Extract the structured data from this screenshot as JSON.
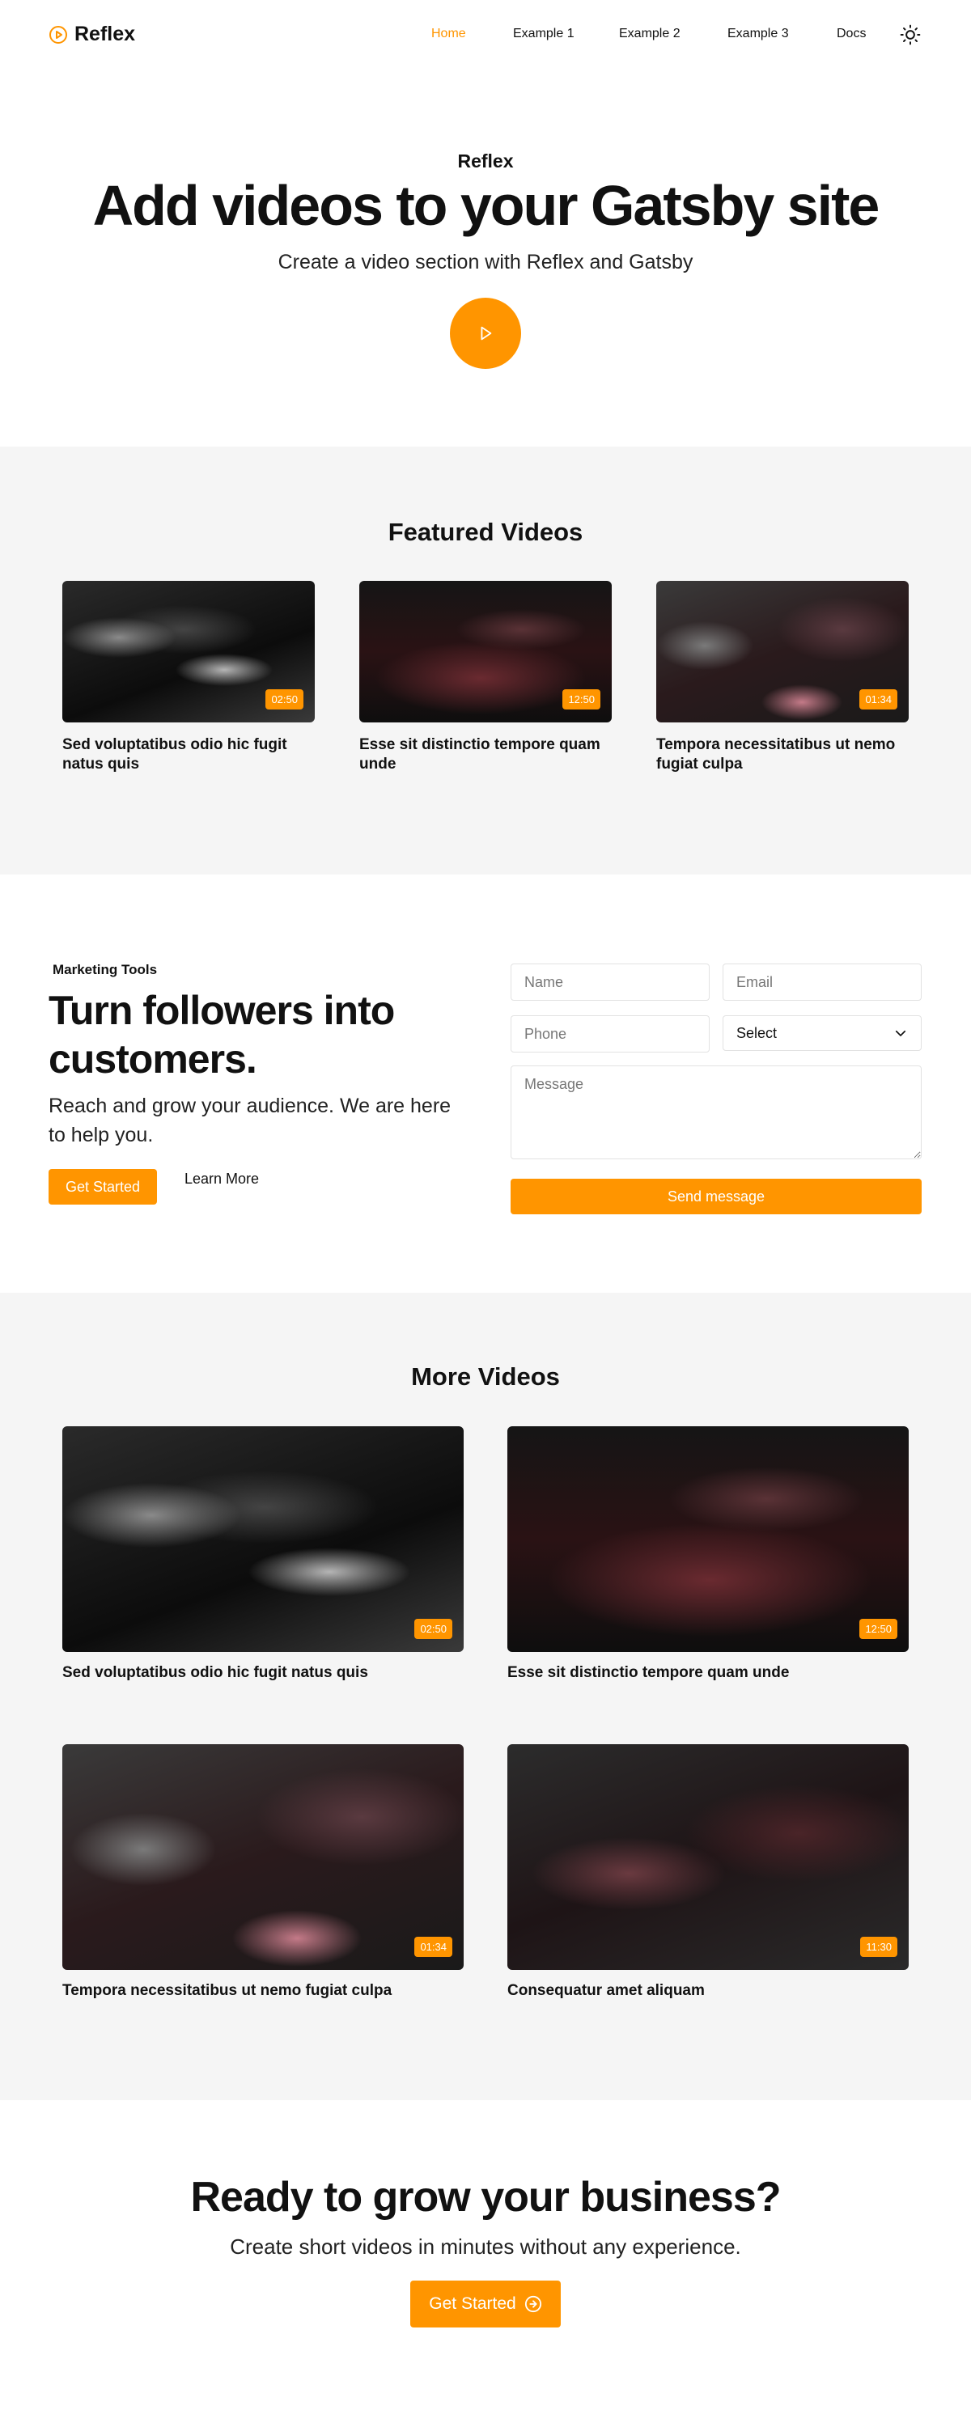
{
  "header": {
    "brand": "Reflex",
    "nav": [
      {
        "label": "Home",
        "active": true
      },
      {
        "label": "Example 1",
        "active": false
      },
      {
        "label": "Example 2",
        "active": false
      },
      {
        "label": "Example 3",
        "active": false
      },
      {
        "label": "Docs",
        "active": false
      }
    ],
    "theme_icon": "sun-icon"
  },
  "hero": {
    "eyebrow": "Reflex",
    "title": "Add videos to your Gatsby site",
    "subtitle": "Create a video section with Reflex and Gatsby",
    "play_icon": "play-icon"
  },
  "featured": {
    "title": "Featured Videos",
    "videos": [
      {
        "title": "Sed voluptatibus odio hic fugit natus quis",
        "duration": "02:50"
      },
      {
        "title": "Esse sit distinctio tempore quam unde",
        "duration": "12:50"
      },
      {
        "title": "Tempora necessitatibus ut nemo fugiat culpa",
        "duration": "01:34"
      }
    ]
  },
  "marketing": {
    "eyebrow": "Marketing Tools",
    "title": "Turn followers into customers.",
    "subtitle": "Reach and grow your audience. We are here to help you.",
    "primary_button": "Get Started",
    "secondary_button": "Learn More",
    "form": {
      "name_placeholder": "Name",
      "email_placeholder": "Email",
      "phone_placeholder": "Phone",
      "select_value": "Select",
      "message_placeholder": "Message",
      "submit": "Send message"
    }
  },
  "more": {
    "title": "More Videos",
    "videos": [
      {
        "title": "Sed voluptatibus odio hic fugit natus quis",
        "duration": "02:50"
      },
      {
        "title": "Esse sit distinctio tempore quam unde",
        "duration": "12:50"
      },
      {
        "title": "Tempora necessitatibus ut nemo fugiat culpa",
        "duration": "01:34"
      },
      {
        "title": "Consequatur amet aliquam",
        "duration": "11:30"
      }
    ]
  },
  "cta": {
    "title": "Ready to grow your business?",
    "subtitle": "Create short videos in minutes without any experience.",
    "button": "Get Started"
  },
  "colors": {
    "accent": "#ff9500",
    "section_bg": "#f5f5f5",
    "text": "#111111"
  }
}
